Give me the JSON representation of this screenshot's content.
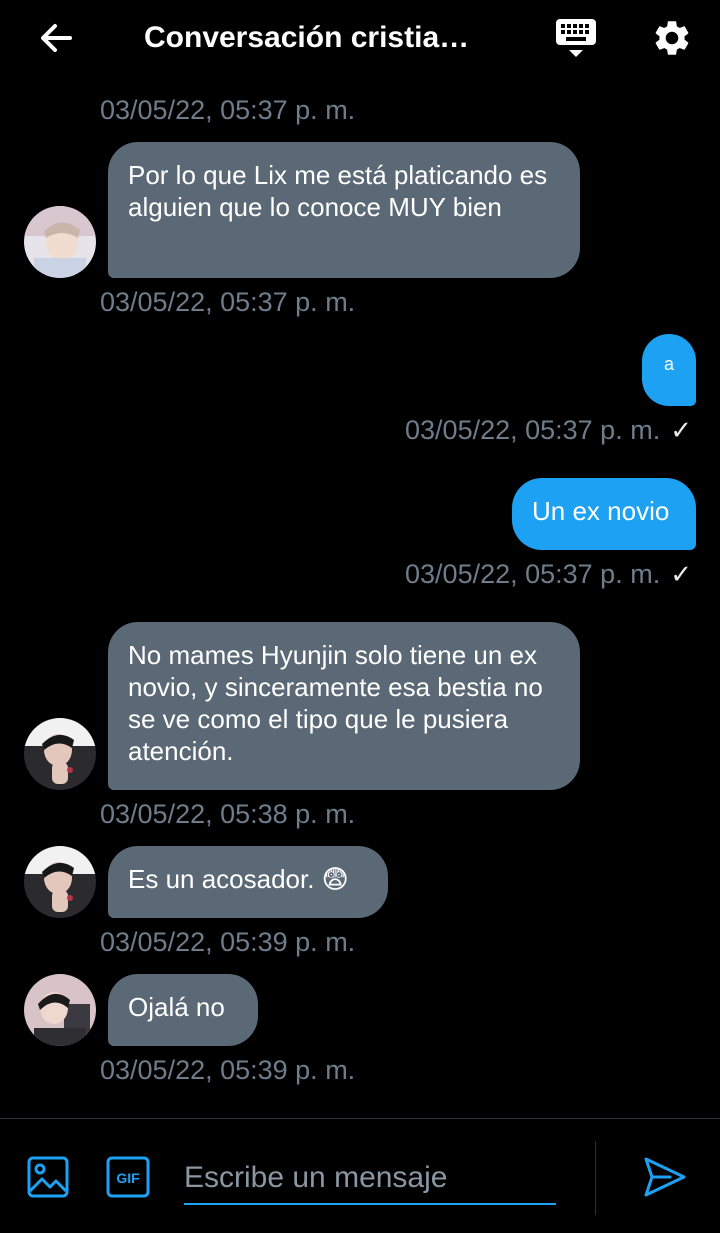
{
  "header": {
    "title": "Conversación cristian…",
    "back_icon": "arrow-left-icon",
    "keyboard_icon": "keyboard-icon",
    "settings_icon": "gear-icon"
  },
  "messages": [
    {
      "timestamp": "03/05/22, 05:37 p. m."
    },
    {
      "direction": "in",
      "text": "Por lo que Lix me está platicando es alguien que lo conoce MUY bien",
      "timestamp": "03/05/22, 05:37 p. m."
    },
    {
      "direction": "out",
      "text": "a",
      "timestamp": "03/05/22, 05:37 p. m.",
      "status": "✓"
    },
    {
      "direction": "out",
      "text": "Un ex novio",
      "timestamp": "03/05/22, 05:37 p. m.",
      "status": "✓"
    },
    {
      "direction": "in",
      "text": "No mames Hyunjin solo tiene un ex novio, y sinceramente esa bestia no se ve como el tipo que le pusiera atención.",
      "timestamp": "03/05/22, 05:38 p. m."
    },
    {
      "direction": "in",
      "text": "Es un acosador. 😨",
      "timestamp": "03/05/22, 05:39 p. m."
    },
    {
      "direction": "in",
      "text": "Ojalá no",
      "timestamp": "03/05/22, 05:39 p. m."
    }
  ],
  "composer": {
    "placeholder": "Escribe un mensaje",
    "image_icon": "image-icon",
    "gif_icon": "gif-icon",
    "gif_label": "GIF",
    "send_icon": "send-icon"
  },
  "colors": {
    "background": "#000000",
    "incoming_bubble": "#5b6876",
    "outgoing_bubble": "#1da1f2",
    "timestamp": "#6e7d8c",
    "accent": "#1da1f2"
  }
}
